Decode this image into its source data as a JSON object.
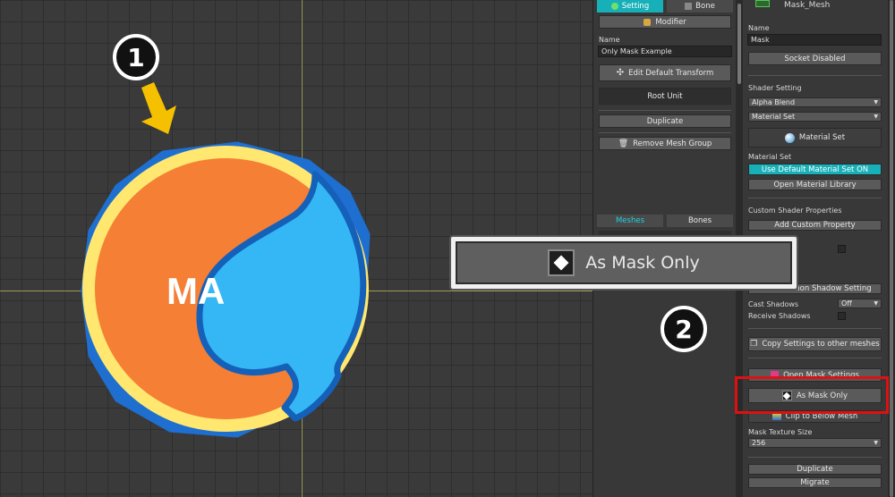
{
  "canvas": {
    "mesh_text": "MA",
    "step1": "1",
    "step2": "2",
    "colors": {
      "outline": "#1e6fd0",
      "yellow": "#ffe770",
      "orange": "#f47f35",
      "blue": "#34b7f4",
      "arrow": "#f5c000"
    }
  },
  "zoom_popup": {
    "label": "As Mask Only",
    "icon": "diamond-icon"
  },
  "left_panel": {
    "tab_setting": "Setting",
    "tab_bone": "Bone",
    "modifier_label": "Modifier",
    "name_label": "Name",
    "name_value": "Only Mask Example",
    "edit_default_transform": "Edit Default Transform",
    "root_unit": "Root Unit",
    "duplicate": "Duplicate",
    "remove_mesh_group": "Remove Mesh Group",
    "tab_meshes": "Meshes",
    "tab_bones": "Bones"
  },
  "right_panel": {
    "mesh_title": "Mask_Mesh",
    "name_label": "Name",
    "name_value": "Mask",
    "socket_disabled": "Socket Disabled",
    "shader_setting": "Shader Setting",
    "shader_blend": "Alpha Blend",
    "material_set_select": "Material Set",
    "material_set_button": "Material Set",
    "material_set_label": "Material Set",
    "use_default_material": "Use Default Material Set ON",
    "open_material_library": "Open Material Library",
    "custom_shader_properties": "Custom Shader Properties",
    "add_custom_property": "Add Custom Property",
    "common_shadow_setting": "Use Common Shadow Setting",
    "cast_shadows_label": "Cast Shadows",
    "cast_shadows_value": "Off",
    "receive_shadows_label": "Receive Shadows",
    "copy_settings": "Copy Settings to other meshes",
    "open_mask_settings": "Open Mask Settings",
    "as_mask_only": "As Mask Only",
    "clip_to_below_mesh": "Clip to Below Mesh",
    "mask_texture_size_label": "Mask Texture Size",
    "mask_texture_size_value": "256",
    "duplicate": "Duplicate",
    "migrate": "Migrate"
  }
}
